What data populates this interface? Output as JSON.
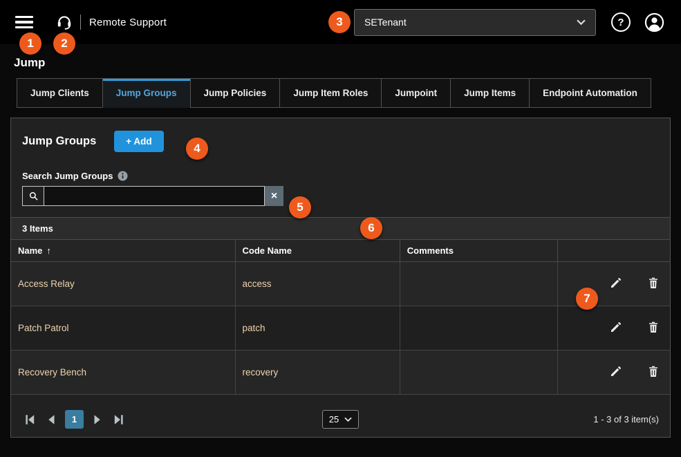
{
  "topbar": {
    "title": "Remote Support",
    "tenant_dropdown": {
      "selected": "SETenant"
    },
    "help_label": "?"
  },
  "page": {
    "title": "Jump"
  },
  "tabs": [
    {
      "label": "Jump Clients"
    },
    {
      "label": "Jump Groups"
    },
    {
      "label": "Jump Policies"
    },
    {
      "label": "Jump Item Roles"
    },
    {
      "label": "Jumpoint"
    },
    {
      "label": "Jump Items"
    },
    {
      "label": "Endpoint Automation"
    }
  ],
  "panel": {
    "heading": "Jump Groups",
    "add_button_label": "+ Add",
    "search": {
      "label": "Search Jump Groups",
      "value": "",
      "clear_label": "×"
    },
    "items_count": "3 Items",
    "table": {
      "columns": [
        "Name",
        "Code Name",
        "Comments"
      ],
      "sort_arrow": "↑",
      "rows": [
        {
          "name": "Access Relay",
          "code_name": "access",
          "comments": ""
        },
        {
          "name": "Patch Patrol",
          "code_name": "patch",
          "comments": ""
        },
        {
          "name": "Recovery Bench",
          "code_name": "recovery",
          "comments": ""
        }
      ]
    },
    "pagination": {
      "current_page": "1",
      "page_size": "25",
      "range_text": "1 - 3 of 3 item(s)"
    }
  },
  "callouts": [
    {
      "n": "1"
    },
    {
      "n": "2"
    },
    {
      "n": "3"
    },
    {
      "n": "4"
    },
    {
      "n": "5"
    },
    {
      "n": "6"
    },
    {
      "n": "7"
    }
  ],
  "colors": {
    "accent_blue": "#2f9ddc",
    "button_blue": "#2193dd",
    "callout_orange": "#ee5a1d",
    "page_badge_blue": "#3a7da1",
    "row_text_tan": "#eed3ae"
  }
}
